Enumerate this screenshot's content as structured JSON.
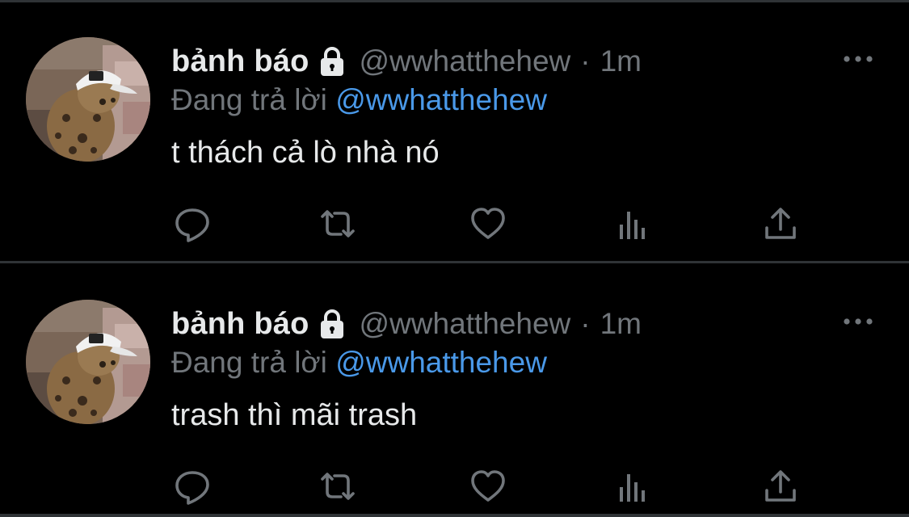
{
  "colors": {
    "background": "#000000",
    "primary_text": "#e7e9ea",
    "secondary_text": "#71767b",
    "mention": "#4a99e9",
    "divider": "#2f3336"
  },
  "tweets": [
    {
      "display_name": "bảnh báo",
      "handle": "@wwhatthehew",
      "separator": "·",
      "time": "1m",
      "reply_prefix": "Đang trả lời",
      "reply_to": "@wwhatthehew",
      "text": "t thách cả lò nhà nó",
      "icons": [
        "lock-icon",
        "more-icon",
        "reply-icon",
        "retweet-icon",
        "like-icon",
        "stats-icon",
        "share-icon"
      ]
    },
    {
      "display_name": "bảnh báo",
      "handle": "@wwhatthehew",
      "separator": "·",
      "time": "1m",
      "reply_prefix": "Đang trả lời",
      "reply_to": "@wwhatthehew",
      "text": "trash thì mãi trash",
      "icons": [
        "lock-icon",
        "more-icon",
        "reply-icon",
        "retweet-icon",
        "like-icon",
        "stats-icon",
        "share-icon"
      ]
    }
  ]
}
